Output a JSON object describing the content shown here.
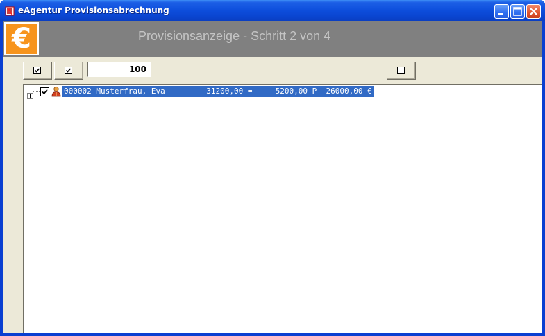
{
  "window": {
    "title": "eAgentur Provisionsabrechnung",
    "icon": "app-calc-icon",
    "buttons": [
      "minimize-icon",
      "maximize-icon",
      "close-icon"
    ]
  },
  "header": {
    "logo": "euro-icon",
    "logo_glyph": "€",
    "step_title": "Provisionsanzeige - Schritt 2 von 4"
  },
  "toolbar": {
    "check_all_icon": "checkbox-checked-icon",
    "check_sel_icon": "checkbox-checked-icon",
    "percent_value": "100",
    "uncheck_icon": "checkbox-empty-icon"
  },
  "tree": {
    "rows": [
      {
        "expander": "plus-expander-icon",
        "checked": true,
        "icon": "person-icon",
        "text": "000002 Musterfrau, Eva         31200,00 =     5200,00 P  26000,00 €",
        "selected": true
      }
    ]
  },
  "colors": {
    "titlebar": "#0a45d0",
    "header_band": "#808080",
    "step_title": "#c4c4c4",
    "logo_bg": "#f7941d",
    "selection": "#316ac5",
    "face": "#ece9d8"
  }
}
